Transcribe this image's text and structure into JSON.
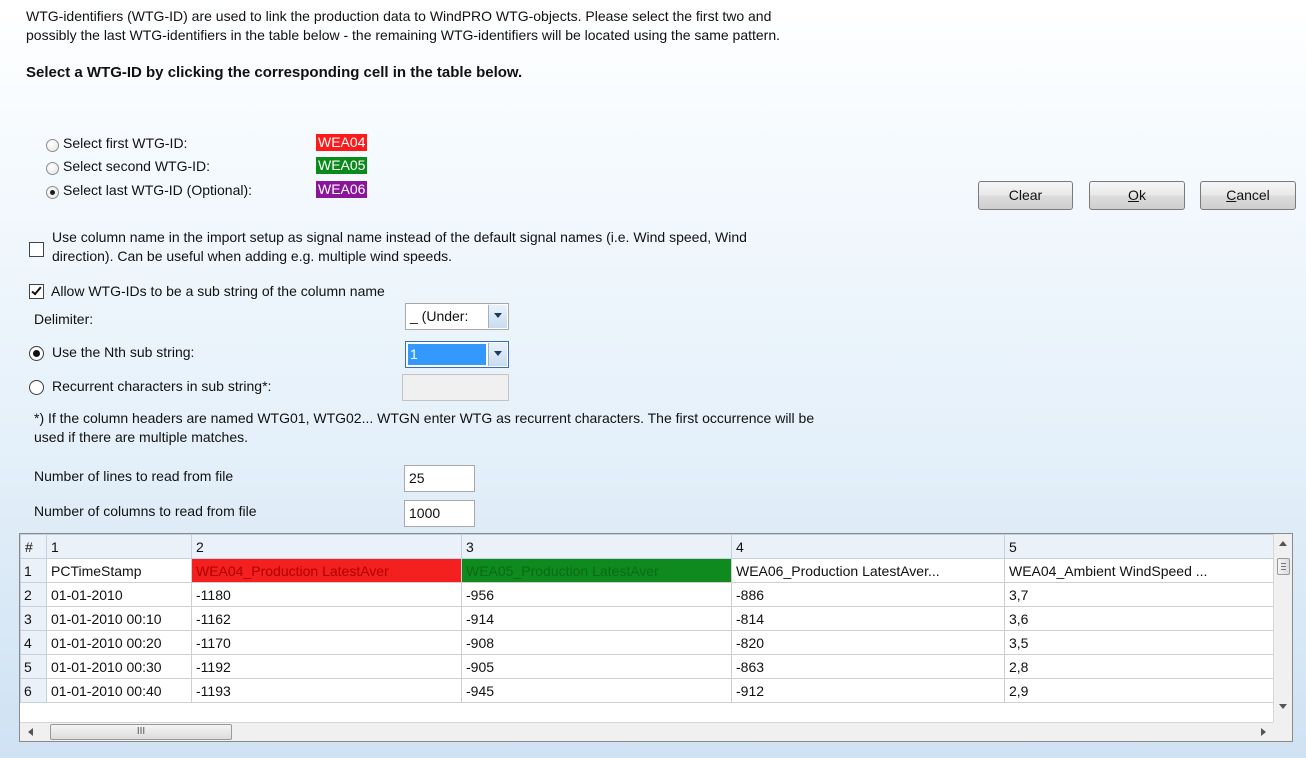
{
  "intro": {
    "line1": "WTG-identifiers (WTG-ID) are used to link the production data to WindPRO WTG-objects. Please select the first two and",
    "line2": "possibly the last WTG-identifiers in the table below - the remaining WTG-identifiers will be located using the same pattern.",
    "instruction": "Select a WTG-ID by clicking the corresponding cell in the table below."
  },
  "selection": {
    "options": [
      {
        "label": "Select first WTG-ID:",
        "value": "WEA04",
        "color": "#ff1a1a",
        "checked": false
      },
      {
        "label": "Select second WTG-ID:",
        "value": "WEA05",
        "color": "#0a8a1a",
        "checked": false
      },
      {
        "label": "Select last WTG-ID (Optional):",
        "value": "WEA06",
        "color": "#8a149a",
        "checked": true
      }
    ]
  },
  "buttons": {
    "clear": "Clear",
    "ok_key": "O",
    "ok_rest": "k",
    "cancel_key": "C",
    "cancel_rest": "ancel"
  },
  "options": {
    "use_column_name_line1": "Use column name in the import setup as signal name instead of the default signal names (i.e. Wind speed, Wind",
    "use_column_name_line2": "direction). Can be useful when adding e.g. multiple wind speeds.",
    "use_column_name_checked": false,
    "allow_substring": "Allow WTG-IDs to be a sub string of the column name",
    "allow_substring_checked": true
  },
  "substring": {
    "delimiter_label": "Delimiter:",
    "delimiter_value": "_ (Under:",
    "nth_label": "Use the Nth sub string:",
    "nth_value": "1",
    "nth_checked": true,
    "recurrent_label": "Recurrent characters in sub string*:",
    "recurrent_checked": false,
    "note_line1": "*) If the column headers are named WTG01, WTG02... WTGN enter WTG as recurrent characters. The first occurrence will be",
    "note_line2": "used if there are multiple matches."
  },
  "read": {
    "lines_label": "Number of lines to read from file",
    "lines_value": "25",
    "columns_label": "Number of columns to read from file",
    "columns_value": "1000"
  },
  "grid": {
    "header": [
      "#",
      "1",
      "2",
      "3",
      "4",
      "5"
    ],
    "rows": [
      [
        "1",
        "PCTimeStamp",
        "WEA04_Production LatestAver",
        "WEA05_Production LatestAver",
        "WEA06_Production LatestAver...",
        "WEA04_Ambient WindSpeed ..."
      ],
      [
        "2",
        "01-01-2010",
        "-1180",
        "-956",
        "-886",
        "3,7"
      ],
      [
        "3",
        "01-01-2010 00:10",
        "-1162",
        "-914",
        "-814",
        "3,6"
      ],
      [
        "4",
        "01-01-2010 00:20",
        "-1170",
        "-908",
        "-820",
        "3,5"
      ],
      [
        "5",
        "01-01-2010 00:30",
        "-1192",
        "-905",
        "-863",
        "2,8"
      ],
      [
        "6",
        "01-01-2010 00:40",
        "-1193",
        "-945",
        "-912",
        "2,9"
      ]
    ],
    "highlight_colors": {
      "first": "#f41f1f",
      "second": "#0f8a1f"
    },
    "hscroll_grip": "III"
  }
}
